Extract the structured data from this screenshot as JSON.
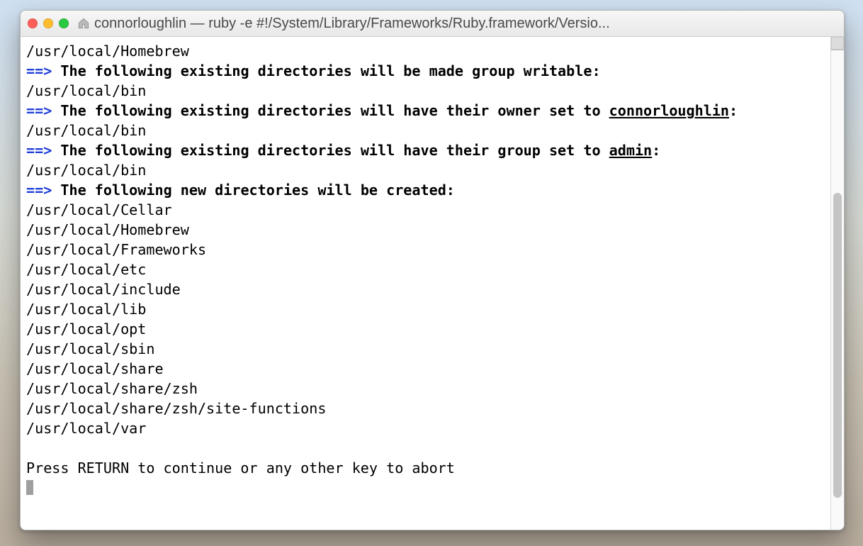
{
  "window": {
    "title": "connorloughlin — ruby -e #!/System/Library/Frameworks/Ruby.framework/Versio..."
  },
  "terminal": {
    "line_homebrew": "/usr/local/Homebrew",
    "arrow": "==>",
    "heading_group_writable": "The following existing directories will be made group writable:",
    "dir_bin": "/usr/local/bin",
    "heading_owner_pre": "The following existing directories will have their owner set to ",
    "owner_user": "connorloughlin",
    "owner_colon": ":",
    "heading_group_pre": "The following existing directories will have their group set to ",
    "group_name": "admin",
    "group_colon": ":",
    "heading_new_dirs": "The following new directories will be created:",
    "new_dirs": [
      "/usr/local/Cellar",
      "/usr/local/Homebrew",
      "/usr/local/Frameworks",
      "/usr/local/etc",
      "/usr/local/include",
      "/usr/local/lib",
      "/usr/local/opt",
      "/usr/local/sbin",
      "/usr/local/share",
      "/usr/local/share/zsh",
      "/usr/local/share/zsh/site-functions",
      "/usr/local/var"
    ],
    "prompt": "Press RETURN to continue or any other key to abort"
  }
}
